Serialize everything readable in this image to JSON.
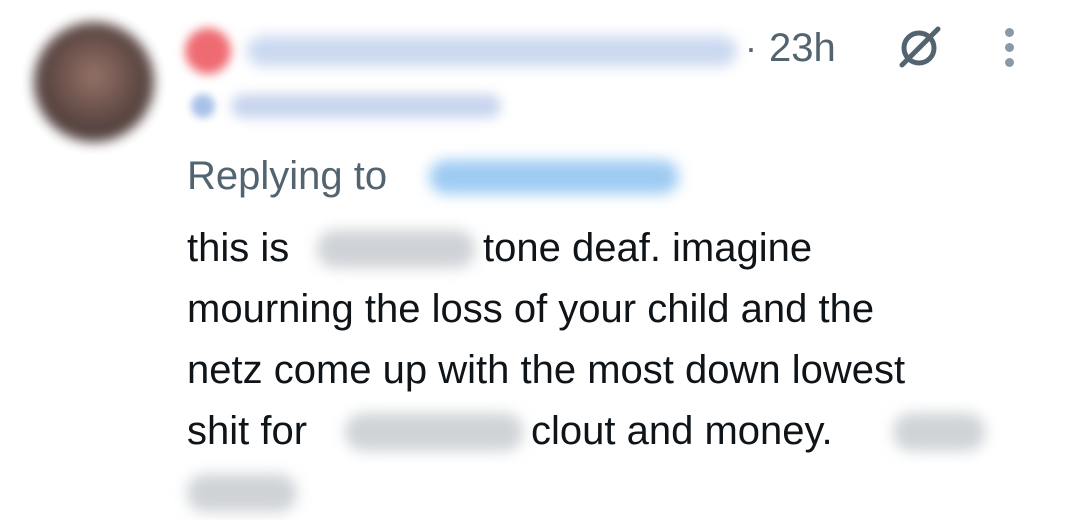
{
  "tweet": {
    "timestamp_separator": "·",
    "timestamp": "23h",
    "replying_label": "Replying to",
    "body": {
      "line1_a": "this is",
      "line1_b": "tone deaf. imagine",
      "line2": "mourning the loss of your child and the",
      "line3": "netz come up with the most down lowest",
      "line4_a": "shit for",
      "line4_b": "clout and money."
    }
  },
  "icons": {
    "grok": "grok-icon",
    "more": "more-icon"
  },
  "colors": {
    "secondary_text": "#536471",
    "primary_text": "#0f1419",
    "handle_blue": "#9ecbf2",
    "badge_red": "#ef6b72"
  }
}
